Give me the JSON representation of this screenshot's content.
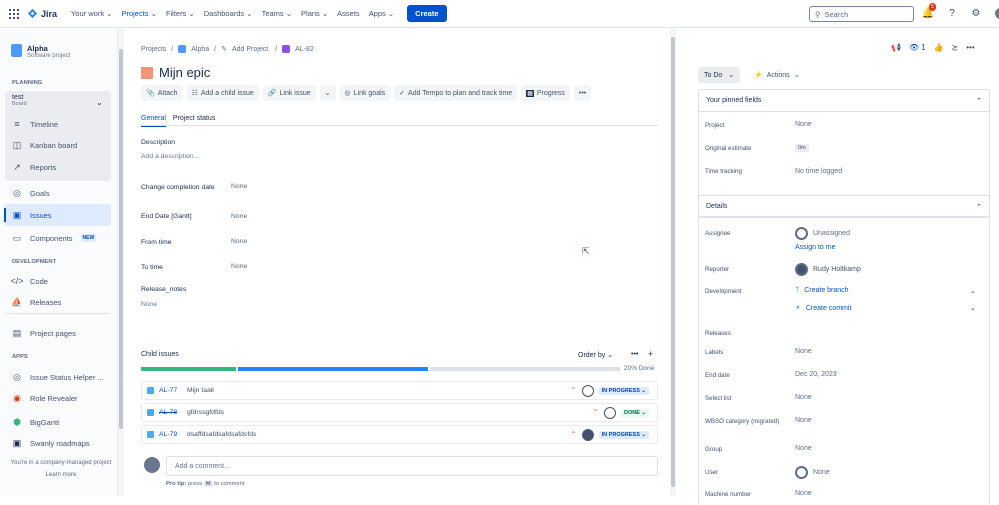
{
  "topbar": {
    "logo": "Jira",
    "nav": [
      "Your work",
      "Projects",
      "Filters",
      "Dashboards",
      "Teams",
      "Plans",
      "Assets",
      "Apps"
    ],
    "nav_active": "Projects",
    "create": "Create",
    "search_placeholder": "Search",
    "notification_count": "5"
  },
  "sidebar": {
    "project_name": "Alpha",
    "project_type": "Software project",
    "planning_label": "PLANNING",
    "board_name": "test",
    "board_type": "Board",
    "planning_items": [
      "Timeline",
      "Kanban board",
      "Reports"
    ],
    "items": [
      "Goals",
      "Issues",
      "Components"
    ],
    "components_badge": "NEW",
    "development_label": "DEVELOPMENT",
    "development_items": [
      "Code",
      "Releases"
    ],
    "project_pages": "Project pages",
    "apps_label": "APPS",
    "apps": [
      "Issue Status Helper ...",
      "Role Revealer",
      "BigGantt",
      "Swanly roadmaps"
    ],
    "footer": "You're in a company-managed project",
    "learn_more": "Learn more"
  },
  "issue": {
    "breadcrumbs": [
      "Projects",
      "Alpha",
      "Add Project",
      "AL-82"
    ],
    "title": "Mijn epic",
    "buttons": [
      "Attach",
      "Add a child issue",
      "Link issue",
      "Link goals",
      "Add Tempo to plan and track time",
      "Progress"
    ],
    "tabs": [
      "General",
      "Project status"
    ],
    "description_label": "Description",
    "description_placeholder": "Add a description...",
    "fields": [
      {
        "label": "Change completion date",
        "value": "None"
      },
      {
        "label": "End Date [Gantt]",
        "value": "None"
      },
      {
        "label": "From time",
        "value": "None"
      },
      {
        "label": "To time",
        "value": "None"
      }
    ],
    "release_notes_label": "Release_notes",
    "release_notes_value": "None",
    "child_issues_label": "Child issues",
    "order_by": "Order by",
    "progress_text": "20% Done",
    "progress": {
      "done": 0.2,
      "in_progress": 0.4,
      "todo": 0.4
    },
    "children": [
      {
        "key": "AL-77",
        "summary": "Mijn taak",
        "status": "IN PROGRESS",
        "done": false
      },
      {
        "key": "AL-78",
        "summary": "gfdrssgfdfds",
        "status": "DONE",
        "done": true
      },
      {
        "key": "AL-79",
        "summary": "dsaffdsafdsafdsafdsfds",
        "status": "IN PROGRESS",
        "done": false
      }
    ],
    "comment_placeholder": "Add a comment...",
    "protip_pre": "Pro tip:",
    "protip_press": "press",
    "protip_key": "M",
    "protip_post": "to comment"
  },
  "right": {
    "watchers": "1",
    "status_button": "To Do",
    "actions_button": "Actions",
    "pinned_title": "Your pinned fields",
    "pinned": [
      {
        "label": "Project",
        "value": "None"
      },
      {
        "label": "Original estimate",
        "value": "0m"
      },
      {
        "label": "Time tracking",
        "value": "No time logged"
      }
    ],
    "details_title": "Details",
    "assignee_label": "Assignee",
    "assignee_value": "Unassigned",
    "assign_to_me": "Assign to me",
    "reporter_label": "Reporter",
    "reporter_value": "Rudy Holtkamp",
    "development_label": "Development",
    "create_branch": "Create branch",
    "create_commit": "Create commit",
    "details": [
      {
        "label": "Releases",
        "value": ""
      },
      {
        "label": "Labels",
        "value": "None"
      },
      {
        "label": "End date",
        "value": "Dec 20, 2023"
      },
      {
        "label": "Select list",
        "value": "None"
      },
      {
        "label": "WBSO category (migrated)",
        "value": "None"
      },
      {
        "label": "Group",
        "value": "None"
      },
      {
        "label": "User",
        "value": "None"
      },
      {
        "label": "Machine number",
        "value": "None"
      }
    ]
  }
}
